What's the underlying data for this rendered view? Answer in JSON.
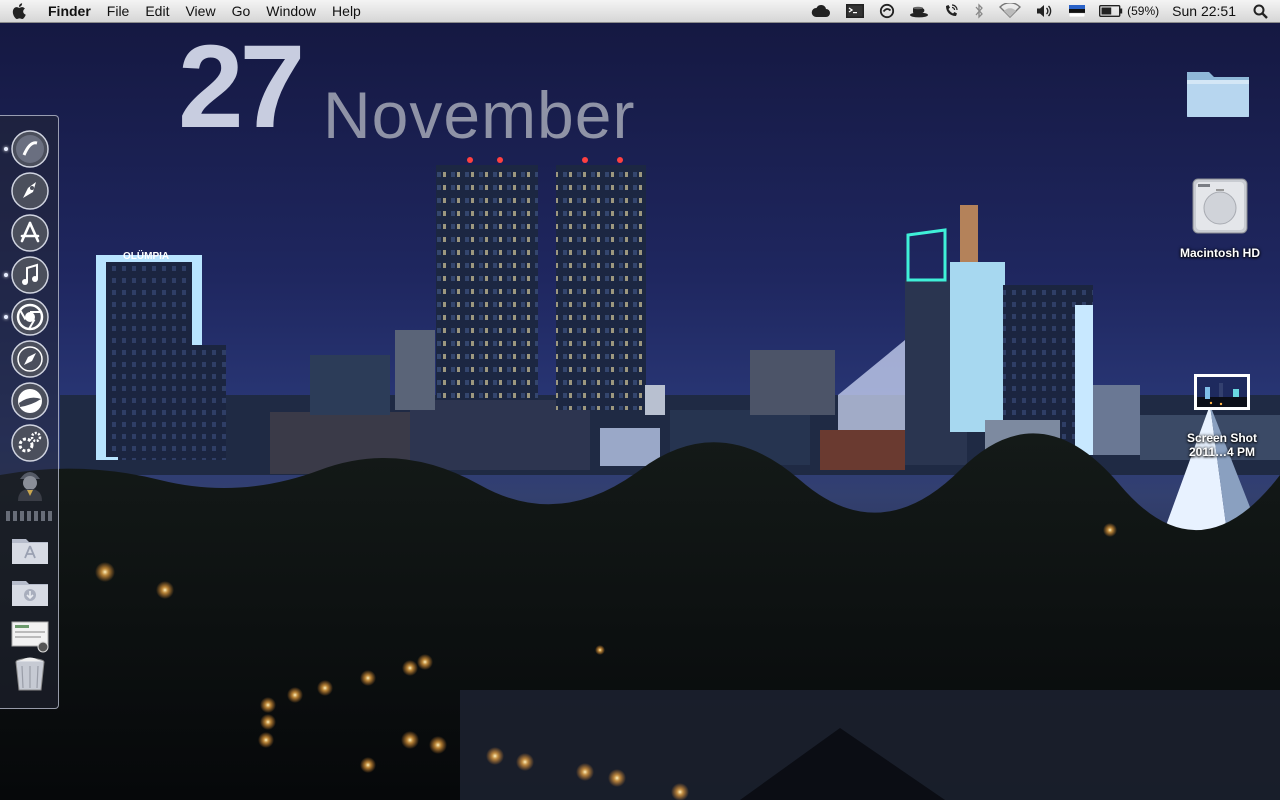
{
  "menubar": {
    "apple_icon": "apple-logo-icon",
    "app_name": "Finder",
    "menus": [
      "File",
      "Edit",
      "View",
      "Go",
      "Window",
      "Help"
    ],
    "status_icons": [
      "cloud-icon",
      "terminal-icon",
      "sync-icon",
      "coffee-cup-icon",
      "phone-signal-icon",
      "bluetooth-icon",
      "wifi-icon",
      "volume-icon",
      "estonia-flag-icon",
      "battery-icon"
    ],
    "battery_percent_text": "(59%)",
    "battery_level": 0.59,
    "clock": "Sun 22:51",
    "search_icon": "spotlight-search-icon"
  },
  "date_widget": {
    "day": "27",
    "month": "November"
  },
  "dock": {
    "apps": [
      {
        "icon": "finder-icon",
        "running": true
      },
      {
        "icon": "launchpad-icon",
        "running": false
      },
      {
        "icon": "app-store-icon",
        "running": false
      },
      {
        "icon": "itunes-icon",
        "running": true
      },
      {
        "icon": "chrome-icon",
        "running": true
      },
      {
        "icon": "safari-icon",
        "running": false
      },
      {
        "icon": "google-earth-icon",
        "running": false
      },
      {
        "icon": "system-preferences-icon",
        "running": false
      },
      {
        "icon": "alfred-icon",
        "running": false
      }
    ],
    "stacks": [
      {
        "icon": "applications-folder-icon"
      },
      {
        "icon": "downloads-folder-icon"
      },
      {
        "icon": "document-stack-icon"
      },
      {
        "icon": "trash-icon"
      }
    ]
  },
  "desktop": {
    "folder": {
      "icon": "folder-icon",
      "label": ""
    },
    "drive": {
      "icon": "hard-drive-icon",
      "label": "Macintosh HD"
    },
    "screenshot": {
      "icon": "screenshot-thumbnail-icon",
      "label_line1": "Screen Shot",
      "label_line2": "2011…4 PM"
    }
  },
  "colors": {
    "sky_top": "#1a1d4d",
    "sky_bottom": "#2a3a78",
    "date_day": "#c8cde0",
    "date_month": "#8f93a6",
    "tower_cyan": "#7fe6ff",
    "street_light": "#ffb347"
  }
}
